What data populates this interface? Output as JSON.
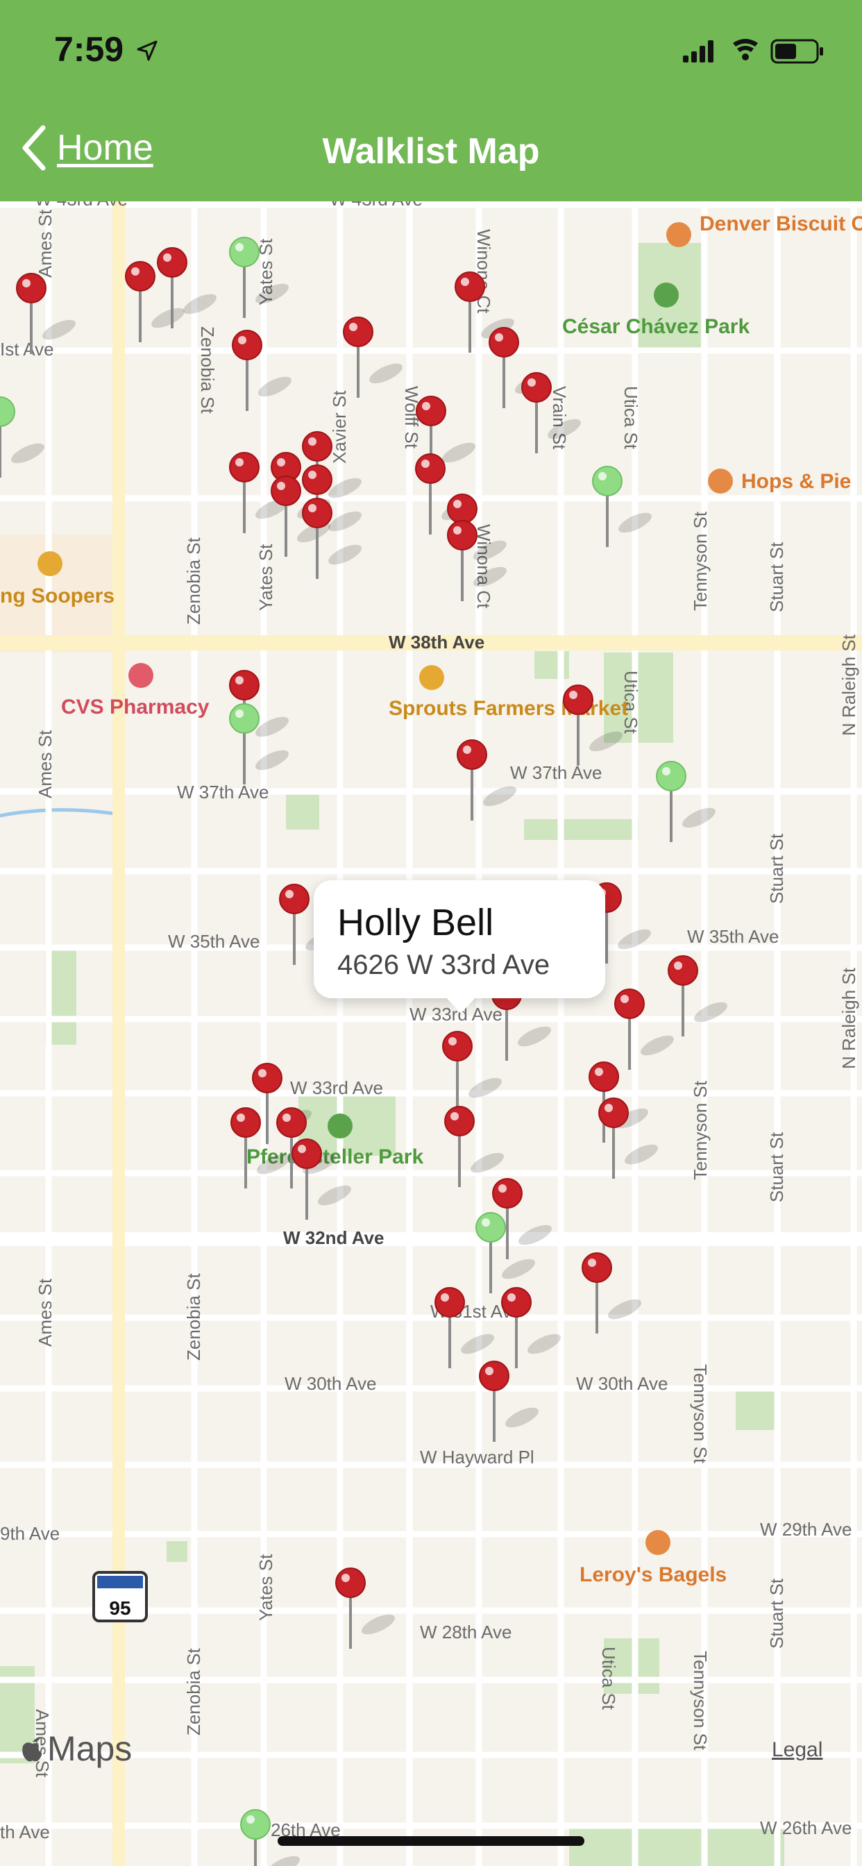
{
  "status_bar": {
    "time": "7:59"
  },
  "nav": {
    "back_label": "Home",
    "title": "Walklist Map"
  },
  "callout": {
    "name": "Holly Bell",
    "address": "4626 W 33rd Ave"
  },
  "map_labels": {
    "street_labels": [
      "W 43rd Ave",
      "W 43rd Ave",
      "Ames St",
      "Zenobia St",
      "Yates St",
      "Winona Ct",
      "Ist Ave",
      "Xavier St",
      "Wolff St",
      "Vrain St",
      "Utica St",
      "Zenobia St",
      "Yates St",
      "Winona Ct",
      "Tennyson St",
      "Stuart St",
      "W 38th Ave",
      "Utica St",
      "N Raleigh St",
      "Ames St",
      "W 37th Ave",
      "W 37th Ave",
      "Stuart St",
      "W 35th Ave",
      "W 35th Ave",
      "W 33rd Ave",
      "W 33rd Ave",
      "Tennyson St",
      "Stuart St",
      "N Raleigh St",
      "W 32nd Ave",
      "Ames St",
      "Zenobia St",
      "W 31st Ave",
      "W 30th Ave",
      "W 30th Ave",
      "Tennyson St",
      "W Hayward Pl",
      "9th Ave",
      "W 29th Ave",
      "Yates St",
      "W 28th Ave",
      "Stuart St",
      "Zenobia St",
      "Utica St",
      "Tennyson St",
      "Ames St",
      "th Ave",
      "26th Ave",
      "W 26th Ave"
    ],
    "pois": [
      "Denver Biscuit Co.",
      "César Chávez Park",
      "Hops & Pie",
      "ng Soopers",
      "CVS Pharmacy",
      "Sprouts Farmers Market",
      "Pferdesteller Park",
      "Leroy's Bagels"
    ],
    "highway_shield": "95"
  },
  "footer": {
    "maps_label": "Maps",
    "legal_label": "Legal"
  },
  "colors": {
    "header": "#72b955",
    "pin_red": "#c82127",
    "pin_green": "#8fdc85"
  }
}
